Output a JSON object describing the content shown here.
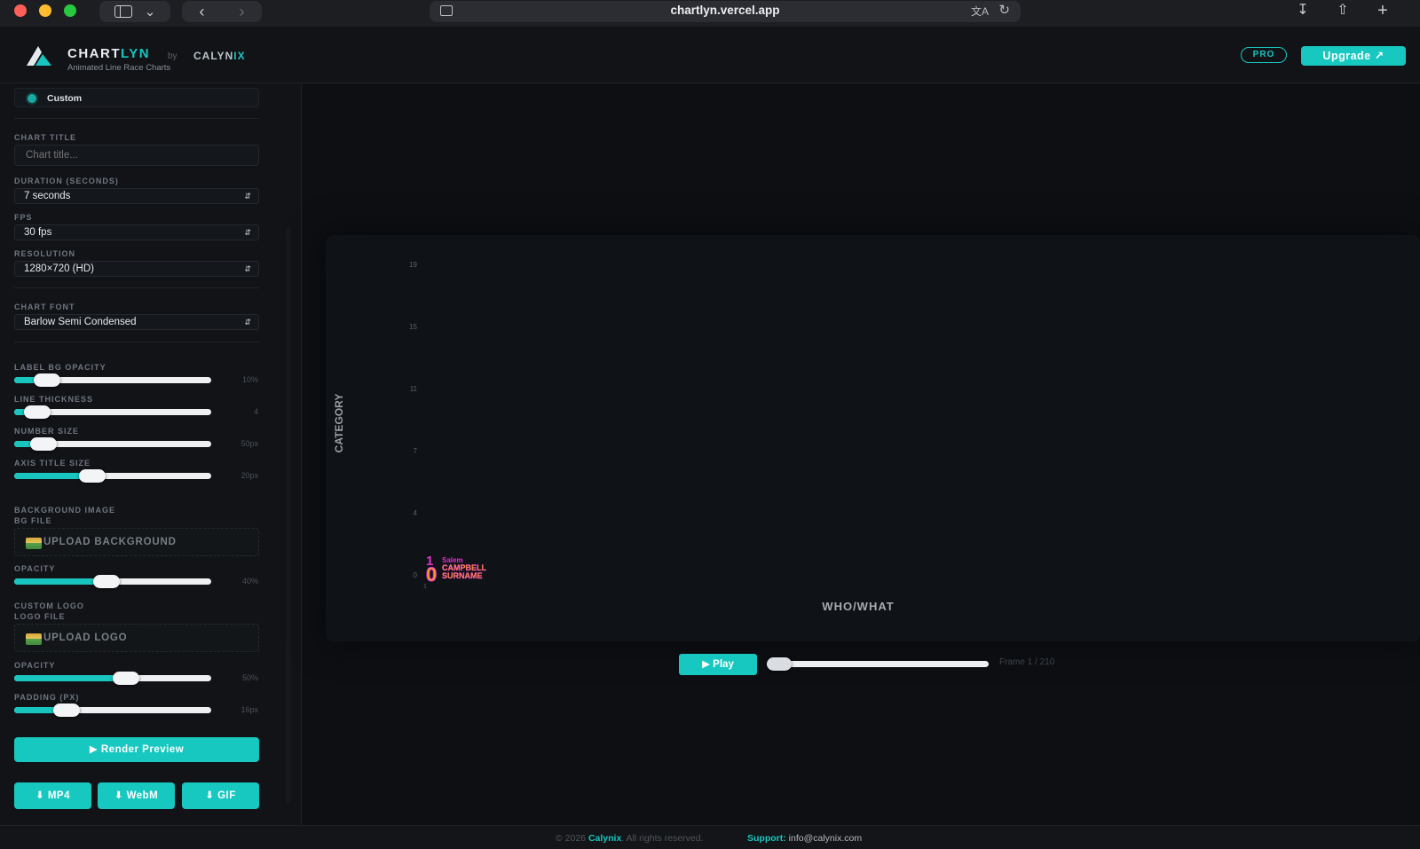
{
  "browser": {
    "url": "chartlyn.vercel.app"
  },
  "header": {
    "brand_a": "CHART",
    "brand_b": "LYN",
    "by": "by",
    "calynix_a": "CALYN",
    "calynix_b": "IX",
    "tagline": "Animated Line Race Charts",
    "pro_badge": "PRO",
    "upgrade_label": "Upgrade ↗"
  },
  "sidebar": {
    "theme_label": "Custom",
    "chart_title_label": "CHART TITLE",
    "chart_title_placeholder": "Chart title...",
    "duration_label": "DURATION (SECONDS)",
    "duration_value": "7 seconds",
    "fps_label": "FPS",
    "fps_value": "30 fps",
    "resolution_label": "RESOLUTION",
    "resolution_value": "1280×720 (HD)",
    "font_label": "CHART FONT",
    "font_value": "Barlow Semi Condensed",
    "sliders": [
      {
        "label": "LABEL BG OPACITY",
        "value": "10%",
        "level": 0.1
      },
      {
        "label": "LINE THICKNESS",
        "value": "4",
        "level": 0.05
      },
      {
        "label": "NUMBER SIZE",
        "value": "50px",
        "level": 0.08
      },
      {
        "label": "AXIS TITLE SIZE",
        "value": "20px",
        "level": 0.33
      }
    ],
    "bg_image_label": "BACKGROUND IMAGE",
    "bg_file_label": "BG FILE",
    "upload_bg_label": "UPLOAD BACKGROUND",
    "bg_opacity_label": "OPACITY",
    "bg_opacity_value": "40%",
    "bg_opacity_level": 0.4,
    "custom_logo_label": "CUSTOM LOGO",
    "logo_file_label": "LOGO FILE",
    "upload_logo_label": "UPLOAD LOGO",
    "logo_opacity_label": "OPACITY",
    "logo_opacity_value": "50%",
    "logo_opacity_level": 0.5,
    "padding_label": "PADDING (PX)",
    "padding_value": "16px",
    "padding_level": 0.2,
    "render_label": "▶  Render Preview",
    "download_mp4": "⬇  MP4",
    "download_webm": "⬇  WebM",
    "download_gif": "⬇  GIF"
  },
  "preview": {
    "play_label": "▶  Play",
    "frame_label": "Frame 1 / 210",
    "scrub_level": 0.0
  },
  "chart_data": {
    "type": "line",
    "ylabel": "CATEGORY",
    "xlabel": "WHO/WHAT",
    "y_ticks": [
      "0",
      "4",
      "7",
      "11",
      "15",
      "19"
    ],
    "x_ticks": [
      "1"
    ],
    "race_label_rank": "1",
    "race_label_value": "0",
    "race_label_line1": "Salem",
    "race_label_line2": "CAMPBELL",
    "race_label_line3": "SURNAME",
    "colors": {
      "accent": "#17c8c0",
      "label_magenta": "#e82fd2",
      "label_orange": "#f5a01a"
    }
  },
  "footer": {
    "copyright_pre": "© 2026 ",
    "copyright_brand": "Calynix",
    "copyright_post": ". All rights reserved.",
    "support_key": "Support:",
    "support_email": " info@calynix.com"
  },
  "colors": {
    "accent": "#17c8c0",
    "background": "#101216"
  }
}
